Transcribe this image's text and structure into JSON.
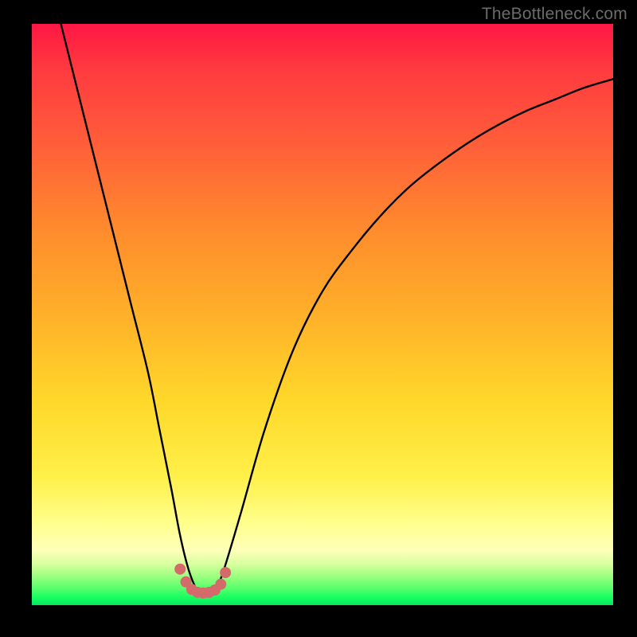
{
  "watermark": "TheBottleneck.com",
  "chart_data": {
    "type": "line",
    "title": "",
    "xlabel": "",
    "ylabel": "",
    "xlim": [
      0,
      100
    ],
    "ylim": [
      0,
      100
    ],
    "series": [
      {
        "name": "bottleneck-curve",
        "x": [
          5,
          8,
          11,
          14,
          17,
          20,
          22,
          24,
          25.5,
          27,
          28.5,
          30,
          31.5,
          33,
          36,
          40,
          45,
          50,
          55,
          60,
          65,
          70,
          75,
          80,
          85,
          90,
          95,
          100
        ],
        "y": [
          100,
          88,
          76,
          64,
          52,
          40,
          30,
          20,
          12,
          6,
          2.5,
          1.5,
          2.5,
          6,
          16,
          30,
          44,
          54,
          61,
          67,
          72,
          76,
          79.5,
          82.5,
          85,
          87,
          89,
          90.5
        ]
      },
      {
        "name": "highlight-dots",
        "x": [
          25.5,
          26.5,
          27.5,
          28.5,
          29.5,
          30.5,
          31.5,
          32.5,
          33.3
        ],
        "y": [
          6.2,
          4.0,
          2.7,
          2.2,
          2.1,
          2.2,
          2.6,
          3.6,
          5.6
        ]
      }
    ],
    "colors": {
      "curve": "#000000",
      "dots": "#d46a6a",
      "gradient_top": "#ff1744",
      "gradient_bottom": "#00e85f"
    }
  }
}
